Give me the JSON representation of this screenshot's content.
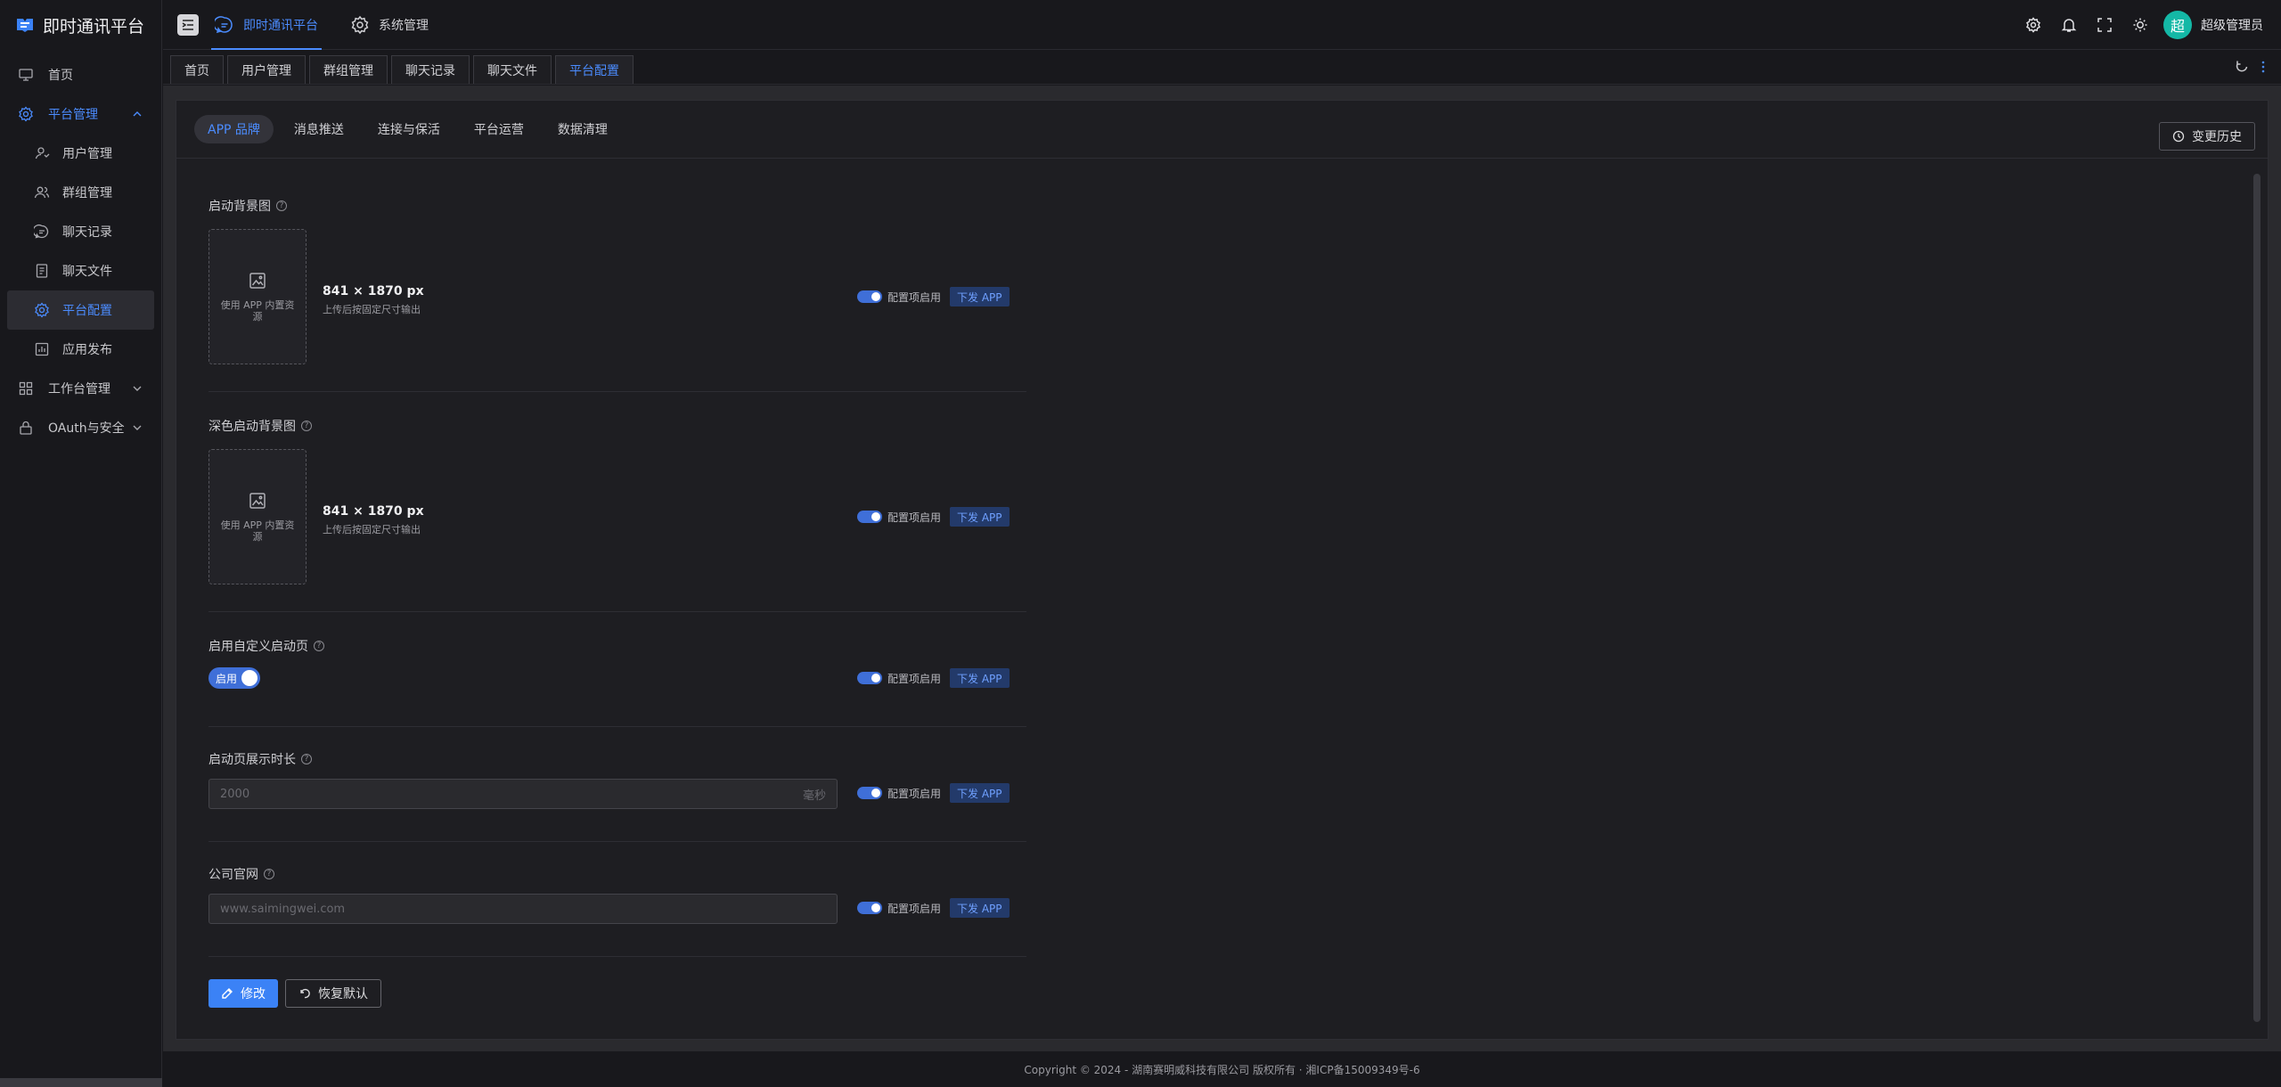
{
  "app": {
    "name": "即时通讯平台"
  },
  "sidebar": {
    "items": [
      {
        "label": "首页"
      },
      {
        "label": "平台管理"
      },
      {
        "label": "用户管理"
      },
      {
        "label": "群组管理"
      },
      {
        "label": "聊天记录"
      },
      {
        "label": "聊天文件"
      },
      {
        "label": "平台配置"
      },
      {
        "label": "应用发布"
      },
      {
        "label": "工作台管理"
      },
      {
        "label": "OAuth与安全"
      }
    ]
  },
  "header": {
    "tabs": [
      {
        "label": "即时通讯平台"
      },
      {
        "label": "系统管理"
      }
    ],
    "avatar_text": "超",
    "user_name": "超级管理员"
  },
  "page_tabs": [
    "首页",
    "用户管理",
    "群组管理",
    "聊天记录",
    "聊天文件",
    "平台配置"
  ],
  "inner_tabs": [
    "APP 品牌",
    "消息推送",
    "连接与保活",
    "平台运营",
    "数据清理"
  ],
  "history_label": "变更历史",
  "form": {
    "splash_bg": {
      "label": "启动背景图",
      "upload_text": "使用 APP 内置资源",
      "size": "841 × 1870 px",
      "size_hint": "上传后按固定尺寸输出"
    },
    "dark_splash_bg": {
      "label": "深色启动背景图",
      "upload_text": "使用 APP 内置资源",
      "size": "841 × 1870 px",
      "size_hint": "上传后按固定尺寸输出"
    },
    "custom_splash": {
      "label": "启用自定义启动页",
      "switch_text": "启用"
    },
    "splash_duration": {
      "label": "启动页展示时长",
      "placeholder": "2000",
      "suffix": "毫秒"
    },
    "company_site": {
      "label": "公司官网",
      "placeholder": "www.saimingwei.com"
    },
    "ctrl_label": "配置项启用",
    "push_label": "下发 APP"
  },
  "actions": {
    "edit": "修改",
    "reset": "恢复默认"
  },
  "footer": "Copyright © 2024 - 湖南赛明威科技有限公司 版权所有 · 湘ICP备15009349号-6",
  "colors": {
    "accent": "#4b8cff",
    "primary_button": "#3b82f6",
    "avatar": "#14b8a6"
  }
}
